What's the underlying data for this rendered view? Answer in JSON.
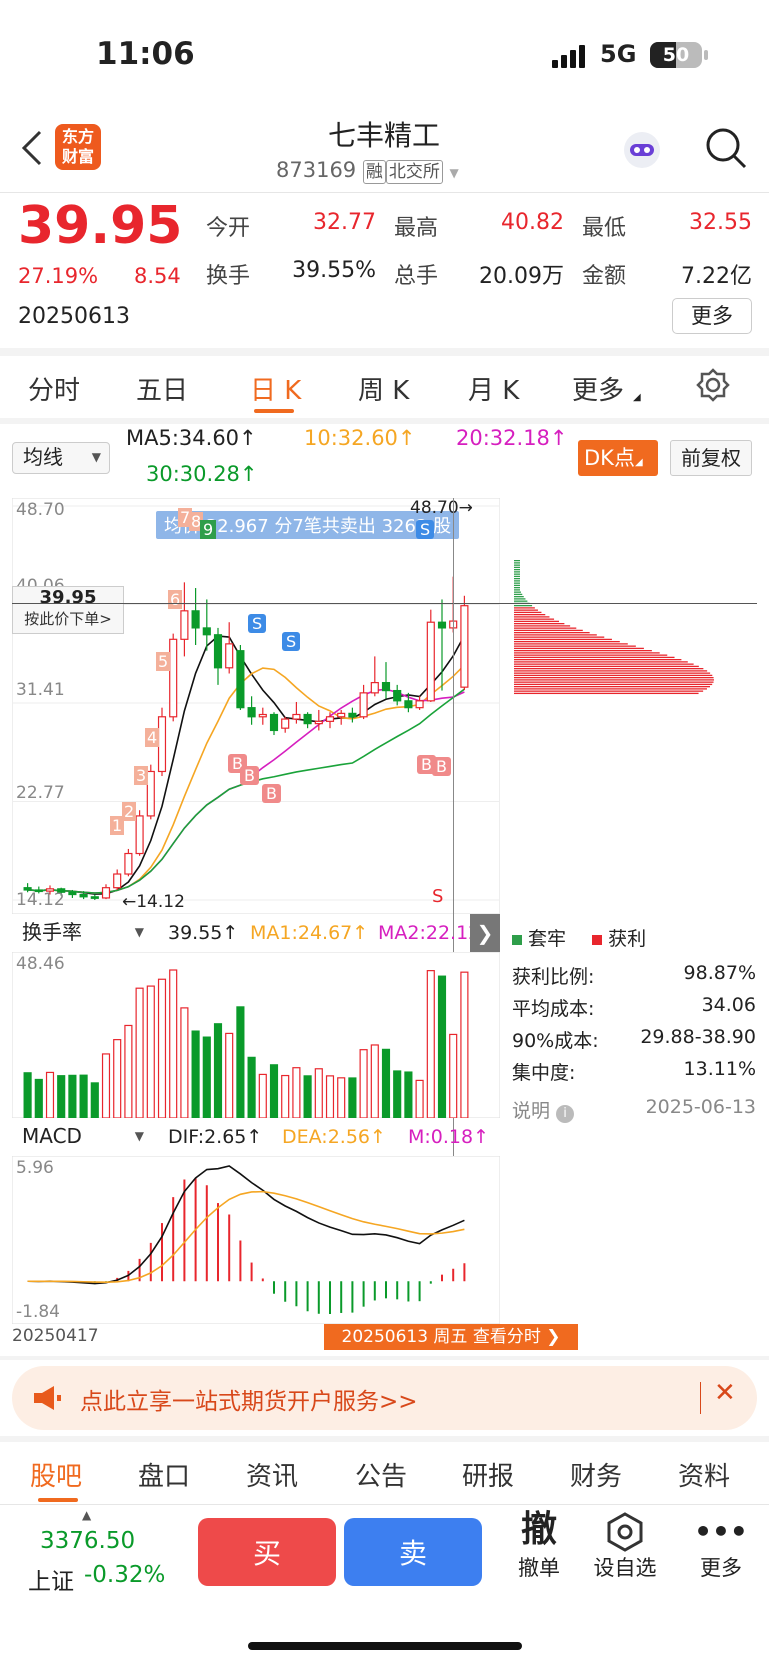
{
  "status_bar": {
    "time": "11:06",
    "network": "5G",
    "battery": "50"
  },
  "header": {
    "app_logo": "东方\n财富",
    "title": "七丰精工",
    "code": "873169",
    "tag1": "融",
    "tag2": "北交所"
  },
  "quote": {
    "price": "39.95",
    "change_pct": "27.19%",
    "change": "8.54",
    "date": "20250613",
    "stats": [
      {
        "label": "今开",
        "value": "32.77"
      },
      {
        "label": "最高",
        "value": "40.82"
      },
      {
        "label": "最低",
        "value": "32.55"
      },
      {
        "label": "换手",
        "value": "39.55%"
      },
      {
        "label": "总手",
        "value": "20.09万"
      },
      {
        "label": "金额",
        "value": "7.22亿"
      }
    ],
    "more_label": "更多"
  },
  "period_tabs": [
    "分时",
    "五日",
    "日 K",
    "周 K",
    "月 K",
    "更多"
  ],
  "ma_bar": {
    "select": "均线",
    "ma5": "MA5:34.60↑",
    "ma10": "10:32.60↑",
    "ma20": "20:32.18↑",
    "ma30": "30:30.28↑",
    "dk_button": "DK点",
    "fuquan_button": "前复权"
  },
  "kline": {
    "y_labels": [
      "48.70",
      "40.06",
      "31.41",
      "22.77",
      "14.12"
    ],
    "tooltip": "均价 32.967 分7笔共卖出 3262 股",
    "high_marker": "48.70→",
    "low_marker": "←14.12",
    "price_tag": "39.95",
    "price_tag_sub": "按此价下单>",
    "count_labels": [
      "1",
      "2",
      "3",
      "4",
      "5",
      "6",
      "7",
      "8",
      "9"
    ],
    "s_label": "S",
    "b_label": "B"
  },
  "chip": {
    "legend_trapped": "套牢",
    "legend_profit": "获利",
    "rows": [
      {
        "label": "获利比例:",
        "value": "98.87%"
      },
      {
        "label": "平均成本:",
        "value": "34.06"
      },
      {
        "label": "90%成本:",
        "value": "29.88-38.90"
      },
      {
        "label": "集中度:",
        "value": "13.11%"
      }
    ],
    "note_label": "说明",
    "note_date": "2025-06-13"
  },
  "turnover": {
    "select": "换手率",
    "value": "39.55↑",
    "ma1": "MA1:24.67↑",
    "ma2": "MA2:22.12↑",
    "y_top": "48.46"
  },
  "macd": {
    "select": "MACD",
    "dif": "DIF:2.65↑",
    "dea": "DEA:2.56↑",
    "m": "M:0.18↑",
    "y_top": "5.96",
    "y_bottom": "-1.84",
    "start_date": "20250417",
    "end_badge": "20250613 周五 查看分时 ❯"
  },
  "banner": {
    "text": "点此立享一站式期货开户服务>>"
  },
  "bottom_tabs": [
    "股吧",
    "盘口",
    "资讯",
    "公告",
    "研报",
    "财务",
    "资料"
  ],
  "footer": {
    "index_value": "3376.50",
    "index_name": "上证",
    "index_change": "-0.32%",
    "buy": "买",
    "sell": "卖",
    "cancel_icon": "撤",
    "cancel": "撤单",
    "add_fav": "设自选",
    "more": "更多"
  },
  "chart_data": {
    "type": "candlestick",
    "ylim": [
      14.12,
      48.7
    ],
    "candles": [
      [
        15.2,
        15.0,
        15.6,
        14.8
      ],
      [
        15.0,
        14.9,
        15.3,
        14.7
      ],
      [
        14.9,
        15.1,
        15.4,
        14.6
      ],
      [
        15.1,
        14.8,
        15.2,
        14.5
      ],
      [
        14.8,
        14.6,
        15.0,
        14.3
      ],
      [
        14.6,
        14.4,
        14.9,
        14.2
      ],
      [
        14.4,
        14.3,
        14.6,
        14.12
      ],
      [
        14.3,
        15.2,
        15.5,
        14.2
      ],
      [
        15.2,
        16.4,
        16.8,
        15.0
      ],
      [
        16.4,
        18.2,
        18.6,
        16.2
      ],
      [
        18.2,
        21.5,
        22.0,
        18.0
      ],
      [
        21.5,
        25.4,
        26.0,
        21.2
      ],
      [
        25.4,
        30.2,
        31.0,
        25.0
      ],
      [
        30.2,
        37.0,
        37.5,
        29.8
      ],
      [
        37.0,
        39.5,
        42.0,
        35.5
      ],
      [
        39.5,
        38.0,
        41.5,
        36.5
      ],
      [
        38.0,
        37.4,
        40.5,
        36.0
      ],
      [
        37.4,
        34.5,
        38.0,
        33.0
      ],
      [
        34.5,
        36.6,
        38.5,
        34.0
      ],
      [
        36.0,
        31.0,
        36.5,
        30.8
      ],
      [
        31.0,
        30.2,
        32.0,
        29.5
      ],
      [
        30.2,
        30.4,
        31.0,
        29.5
      ],
      [
        30.4,
        29.0,
        30.6,
        28.6
      ],
      [
        29.2,
        30.0,
        30.2,
        28.8
      ],
      [
        30.0,
        30.4,
        31.5,
        29.6
      ],
      [
        30.4,
        29.6,
        30.6,
        29.2
      ],
      [
        29.6,
        29.8,
        30.8,
        29.0
      ],
      [
        29.8,
        30.2,
        30.6,
        29.2
      ],
      [
        30.2,
        30.5,
        30.8,
        29.5
      ],
      [
        30.5,
        30.2,
        31.0,
        29.7
      ],
      [
        30.2,
        32.3,
        33.0,
        30.0
      ],
      [
        32.3,
        33.2,
        35.5,
        32.0
      ],
      [
        33.2,
        32.5,
        35.0,
        31.8
      ],
      [
        32.5,
        31.6,
        33.0,
        31.2
      ],
      [
        31.6,
        31.0,
        32.3,
        30.6
      ],
      [
        31.0,
        31.6,
        32.0,
        30.8
      ],
      [
        31.6,
        38.5,
        39.6,
        31.5
      ],
      [
        38.5,
        38.0,
        40.5,
        32.5
      ],
      [
        38.0,
        38.6,
        42.5,
        37.6
      ],
      [
        32.8,
        39.95,
        40.82,
        32.55
      ]
    ]
  }
}
